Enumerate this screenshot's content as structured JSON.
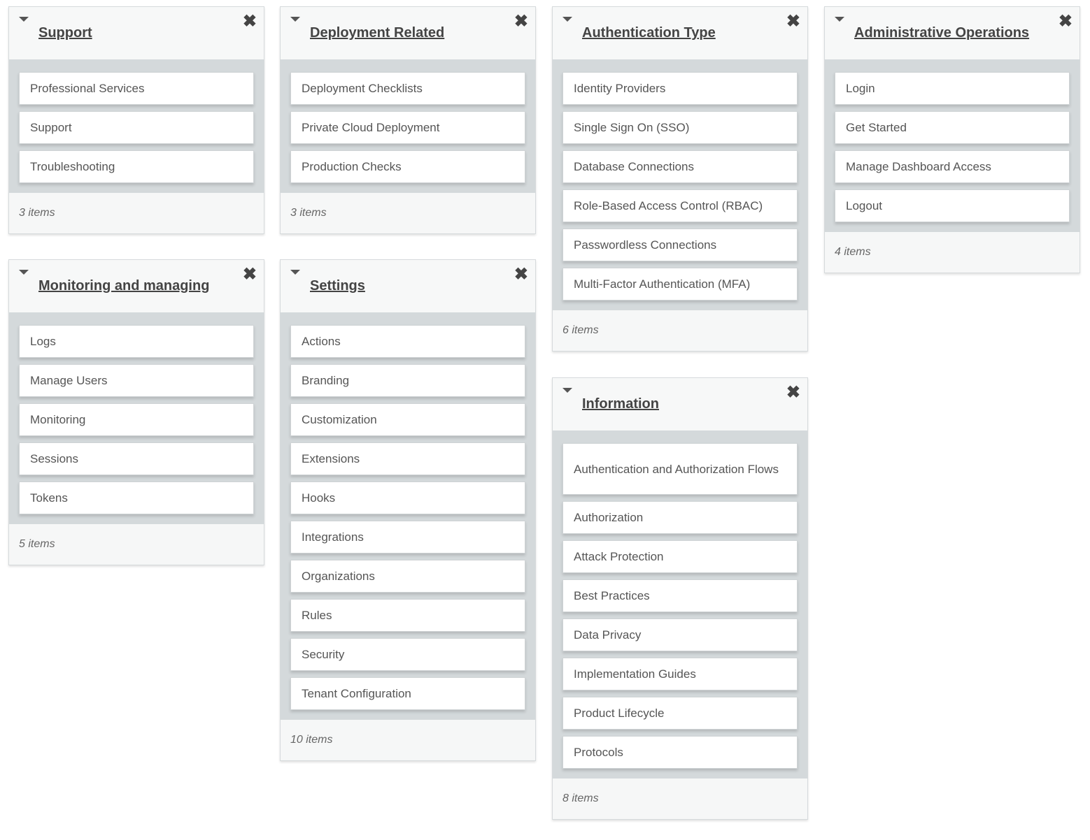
{
  "cards": [
    {
      "title": "Support",
      "items": [
        "Professional Services",
        "Support",
        "Troubleshooting"
      ],
      "count": "3 items"
    },
    {
      "title": "Deployment Related",
      "items": [
        "Deployment Checklists",
        "Private Cloud Deployment",
        "Production Checks"
      ],
      "count": "3 items"
    },
    {
      "title": "Authentication Type",
      "items": [
        "Identity Providers",
        "Single Sign On (SSO)",
        "Database Connections",
        "Role-Based Access Control (RBAC)",
        "Passwordless Connections",
        "Multi-Factor Authentication (MFA)"
      ],
      "count": "6 items"
    },
    {
      "title": "Administrative Operations",
      "items": [
        "Login",
        "Get Started",
        "Manage Dashboard Access",
        "Logout"
      ],
      "count": "4 items"
    },
    {
      "title": "Monitoring and managing",
      "items": [
        "Logs",
        "Manage Users",
        "Monitoring",
        "Sessions",
        "Tokens"
      ],
      "count": "5 items"
    },
    {
      "title": "Settings",
      "items": [
        "Actions",
        "Branding",
        "Customization",
        "Extensions",
        "Hooks",
        "Integrations",
        "Organizations",
        "Rules",
        "Security",
        "Tenant Configuration"
      ],
      "count": "10 items"
    },
    {
      "title": "Information",
      "items": [
        "Authentication and Authorization Flows",
        "Authorization",
        "Attack Protection",
        "Best Practices",
        "Data Privacy",
        "Implementation Guides",
        "Product Lifecycle",
        "Protocols"
      ],
      "count": "8 items"
    }
  ],
  "icons": {
    "collapse": "caret-down-icon",
    "close": "close-icon"
  }
}
